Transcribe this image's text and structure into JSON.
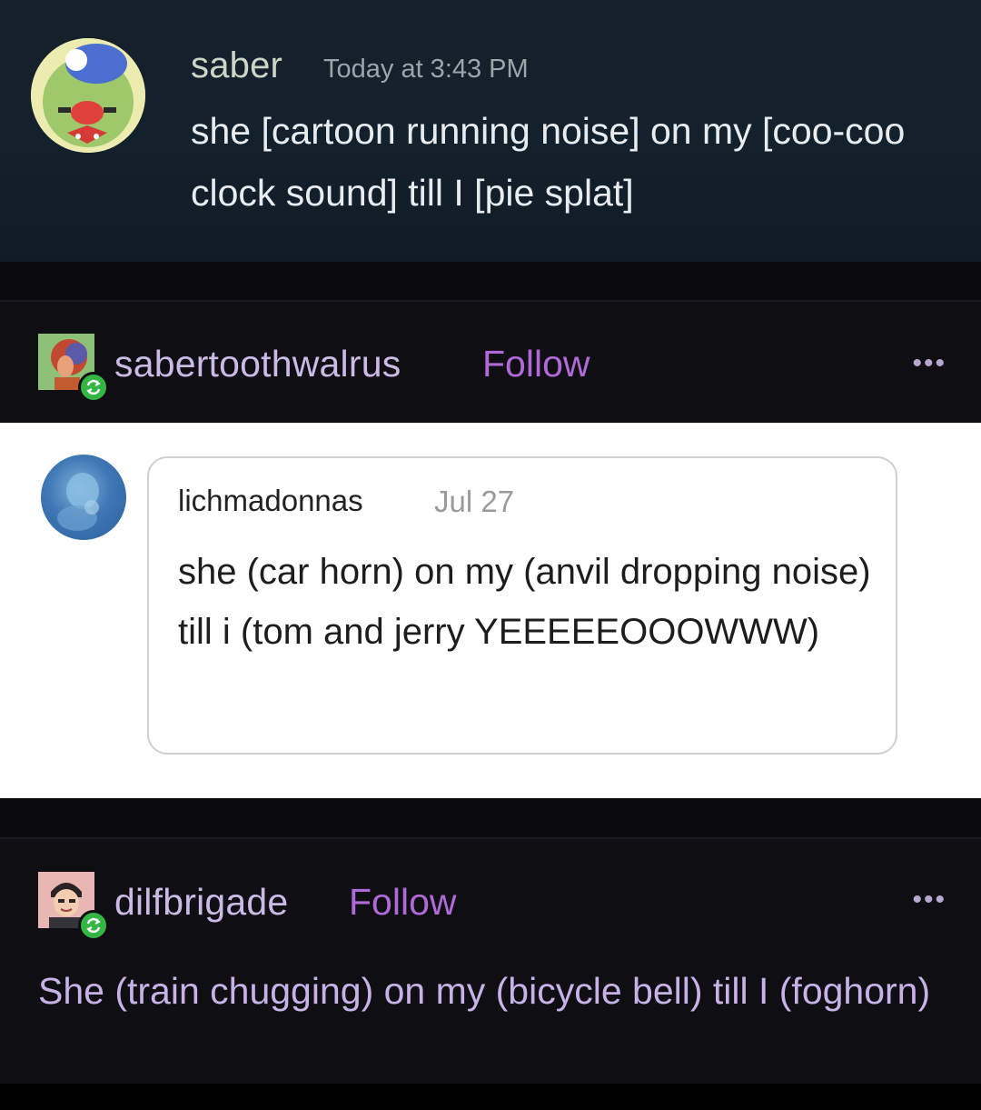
{
  "discord": {
    "username": "saber",
    "timestamp": "Today at 3:43 PM",
    "message": "she [cartoon running noise] on my [coo-coo clock sound] till I [pie splat]"
  },
  "reblog_1": {
    "username": "sabertoothwalrus",
    "follow_label": "Follow",
    "more_label": "•••"
  },
  "quoted_post": {
    "username": "lichmadonnas",
    "date": "Jul 27",
    "text": "she (car horn) on my (anvil dropping noise) till i (tom and jerry YEEEEEOOOWWW)"
  },
  "reblog_2": {
    "username": "dilfbrigade",
    "follow_label": "Follow",
    "more_label": "•••",
    "text": "She (train chugging) on my (bicycle bell) till I (foghorn)"
  },
  "colors": {
    "follow": "#b06ad8",
    "tumblr_text": "#c7b2e8",
    "reblog_badge": "#35b543",
    "discord_bg": "#13212c"
  }
}
